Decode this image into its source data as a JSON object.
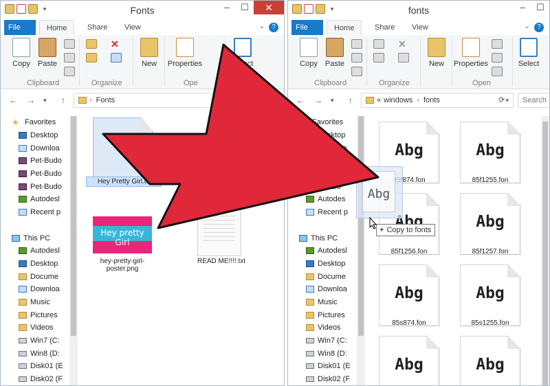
{
  "left_window": {
    "title": "Fonts",
    "tabs": [
      "File",
      "Home",
      "Share",
      "View"
    ],
    "ribbon": {
      "copy": "Copy",
      "paste": "Paste",
      "new": "New",
      "properties": "Properties",
      "open_group": "Ope",
      "select": "Select",
      "groups": [
        "Clipboard",
        "Organize"
      ]
    },
    "address": "Fonts",
    "nav": [
      {
        "label": "Favorites",
        "icon": "star-icon"
      },
      {
        "label": "Desktop",
        "icon": "desktop-icon"
      },
      {
        "label": "Downloa",
        "icon": "downloads-icon"
      },
      {
        "label": "Pet-Budo",
        "icon": "stack-icon"
      },
      {
        "label": "Pet-Budo",
        "icon": "stack-icon"
      },
      {
        "label": "Pet-Budo",
        "icon": "stack-icon"
      },
      {
        "label": "Autodesl",
        "icon": "network-icon"
      },
      {
        "label": "Recent p",
        "icon": "recent-icon"
      },
      {
        "label": "",
        "icon": ""
      },
      {
        "label": "This PC",
        "icon": "computer-icon"
      },
      {
        "label": "Autodesl",
        "icon": "network-icon"
      },
      {
        "label": "Desktop",
        "icon": "desktop-icon"
      },
      {
        "label": "Docume",
        "icon": "folder-icon"
      },
      {
        "label": "Downloa",
        "icon": "downloads-icon"
      },
      {
        "label": "Music",
        "icon": "folder-icon"
      },
      {
        "label": "Pictures",
        "icon": "folder-icon"
      },
      {
        "label": "Videos",
        "icon": "folder-icon"
      },
      {
        "label": "Win7 (C:",
        "icon": "drive-icon"
      },
      {
        "label": "Win8 (D:",
        "icon": "drive-icon"
      },
      {
        "label": "Disk01 (E",
        "icon": "drive-icon"
      },
      {
        "label": "Disk02 (F",
        "icon": "drive-icon"
      }
    ],
    "files": [
      {
        "name": "Hey Pretty Girl.ttf"
      },
      {
        "name": "hey-pretty-girl-poster.png",
        "poster_text": "Hey pretty Girl"
      },
      {
        "name": "READ ME!!!!.txt"
      }
    ]
  },
  "right_window": {
    "title": "fonts",
    "tabs": [
      "File",
      "Home",
      "Share",
      "View"
    ],
    "ribbon": {
      "copy": "Copy",
      "paste": "Paste",
      "new": "New",
      "properties": "Properties",
      "select": "Select",
      "groups": [
        "Clipboard",
        "Organize",
        "Open"
      ]
    },
    "address": [
      "windows",
      "fonts"
    ],
    "address_prefix": "«",
    "search_placeholder": "Search",
    "nav": [
      {
        "label": "Favorites",
        "icon": "star-icon"
      },
      {
        "label": "Desktop",
        "icon": "desktop-icon"
      },
      {
        "label": "Downloa",
        "icon": "downloads-icon"
      },
      {
        "label": "Pet-Bu",
        "icon": "stack-icon"
      },
      {
        "label": "Pet-Bu",
        "icon": "stack-icon"
      },
      {
        "label": "Pet-Bu",
        "icon": "stack-icon"
      },
      {
        "label": "Autodes",
        "icon": "network-icon"
      },
      {
        "label": "Recent p",
        "icon": "recent-icon"
      },
      {
        "label": "",
        "icon": ""
      },
      {
        "label": "This PC",
        "icon": "computer-icon"
      },
      {
        "label": "Autodesl",
        "icon": "network-icon"
      },
      {
        "label": "Desktop",
        "icon": "desktop-icon"
      },
      {
        "label": "Docume",
        "icon": "folder-icon"
      },
      {
        "label": "Downloa",
        "icon": "downloads-icon"
      },
      {
        "label": "Music",
        "icon": "folder-icon"
      },
      {
        "label": "Pictures",
        "icon": "folder-icon"
      },
      {
        "label": "Videos",
        "icon": "folder-icon"
      },
      {
        "label": "Win7 (C:",
        "icon": "drive-icon"
      },
      {
        "label": "Win8 (D:",
        "icon": "drive-icon"
      },
      {
        "label": "Disk01 (E",
        "icon": "drive-icon"
      },
      {
        "label": "Disk02 (F",
        "icon": "drive-icon"
      }
    ],
    "font_sample": "Abg",
    "font_files": [
      "85f874.fon",
      "85f1255.fon",
      "85f1256.fon",
      "85f1257.fon",
      "85s874.fon",
      "85s1255.fon",
      "",
      ""
    ]
  },
  "drag": {
    "sample": "Abg",
    "tooltip": "Copy to fonts"
  },
  "colors": {
    "arrow": "#e0283a",
    "arrow_outline": "#111111",
    "accent": "#1979ca",
    "poster_bg": "#e8267a",
    "poster_band": "#3ab5d8"
  }
}
